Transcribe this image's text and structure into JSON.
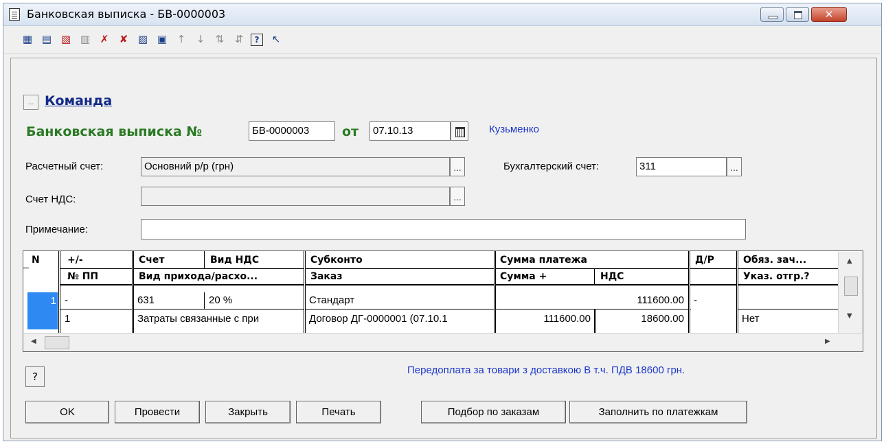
{
  "window": {
    "title": "Банковская выписка - БВ-0000003",
    "close_glyph": "✕"
  },
  "toolbar": [
    {
      "icon": "add-row-icon",
      "glyph": "▦",
      "disabled": false
    },
    {
      "icon": "copy-row-icon",
      "glyph": "▤",
      "disabled": false
    },
    {
      "icon": "delete-row-icon",
      "glyph": "▧",
      "disabled": false,
      "color": "red"
    },
    {
      "icon": "edit-row-icon",
      "glyph": "▥",
      "disabled": true
    },
    {
      "icon": "mark-delete-icon",
      "glyph": "✗",
      "disabled": false,
      "color": "red"
    },
    {
      "icon": "delete-icon",
      "glyph": "✘",
      "disabled": false,
      "color": "red"
    },
    {
      "icon": "columns-icon",
      "glyph": "▨",
      "disabled": false
    },
    {
      "icon": "select-icon",
      "glyph": "▣",
      "disabled": false
    },
    {
      "icon": "move-up-icon",
      "glyph": "↑",
      "disabled": true
    },
    {
      "icon": "move-down-icon",
      "glyph": "↓",
      "disabled": true
    },
    {
      "icon": "sort-asc-icon",
      "glyph": "⇅",
      "disabled": true
    },
    {
      "icon": "sort-desc-icon",
      "glyph": "⇵",
      "disabled": true
    },
    {
      "icon": "help-icon",
      "glyph": "?",
      "disabled": false
    },
    {
      "icon": "context-help-icon",
      "glyph": "↖",
      "disabled": false
    }
  ],
  "command": {
    "label": "Команда",
    "button_glyph": "..."
  },
  "doc": {
    "heading": "Банковская выписка №",
    "number": "БВ-0000003",
    "date_label": "от",
    "date": "07.10.13",
    "author": "Кузьменко"
  },
  "form": {
    "account_label": "Расчетный счет:",
    "account_value": "Основний р/р (грн)",
    "bk_account_label": "Бухгалтерский счет:",
    "bk_account_value": "311",
    "vat_account_label": "Счет НДС:",
    "vat_account_value": "",
    "note_label": "Примечание:",
    "note_value": "",
    "pick_glyph": "..."
  },
  "grid": {
    "header_row1": {
      "n": "N",
      "sign": "+/-",
      "account": "Счет",
      "vat_type": "Вид НДС",
      "subkonto": "Субконто",
      "sum": "Сумма платежа",
      "dr": "Д/Р",
      "oblig": "Обяз. зач..."
    },
    "header_row2": {
      "pp": "№ ПП",
      "income_type": "Вид прихода/расхо...",
      "order": "Заказ",
      "sum_plus": "Сумма +",
      "vat": "НДС",
      "ship": "Указ. отгр.?"
    },
    "row1": {
      "n": "1",
      "sign": "-",
      "account": "631",
      "vat_type": "20 %",
      "subkonto": "Стандарт",
      "sum": "111600.00",
      "dr": "-",
      "oblig": ""
    },
    "row2": {
      "pp": "1",
      "income_type": "Затраты связанные с при",
      "order": "Договор ДГ-0000001 (07.10.1",
      "sum_plus": "111600.00",
      "vat": "18600.00",
      "ship": "Нет"
    },
    "scroll_up": "▲",
    "scroll_down": "▼",
    "scroll_left": "◀",
    "scroll_right": "▶"
  },
  "footer": {
    "help_label": "?",
    "note": "Передоплата за товари з доставкою В т.ч. ПДВ 18600 грн.",
    "buttons": {
      "ok": "OK",
      "post": "Провести",
      "close": "Закрыть",
      "print": "Печать",
      "pick_orders": "Подбор по заказам",
      "fill_payments": "Заполнить по платежкам"
    }
  }
}
